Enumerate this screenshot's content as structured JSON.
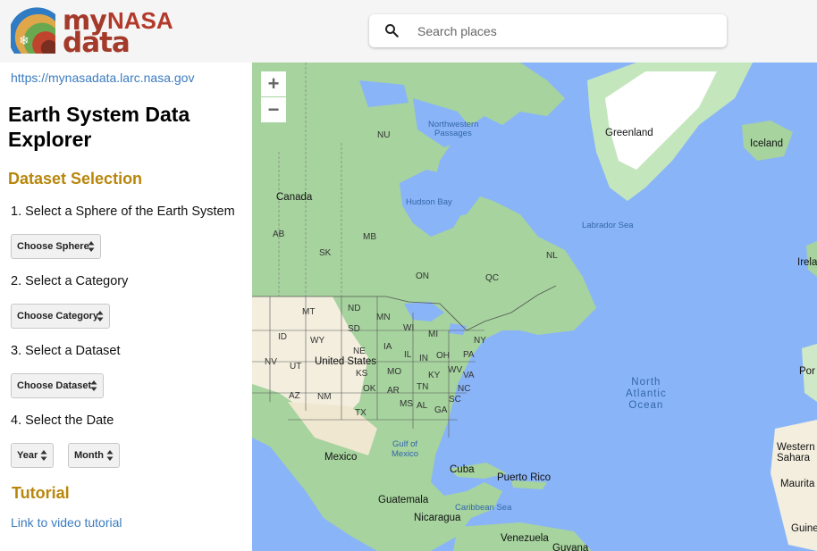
{
  "header": {
    "logo": {
      "word1": "my",
      "word2": "NASA",
      "word3": "data"
    },
    "search": {
      "placeholder": "Search places",
      "value": ""
    }
  },
  "sidebar": {
    "site_link": "https://mynasadata.larc.nasa.gov",
    "title_line1": "Earth System Data",
    "title_line2": "Explorer",
    "dataset_heading": "Dataset Selection",
    "step1": "1. Select a Sphere of the Earth System",
    "sphere_select": "Choose Sphere",
    "step2": "2. Select a Category",
    "category_select": "Choose Category",
    "step3": "3. Select a Dataset",
    "dataset_select": "Choose Dataset",
    "step4": "4. Select the Date",
    "year_select": "Year",
    "month_select": "Month",
    "tutorial_heading": "Tutorial",
    "tutorial_link": "Link to video tutorial"
  },
  "map": {
    "zoom_in": "+",
    "zoom_out": "−",
    "labels": {
      "greenland": "Greenland",
      "iceland": "Iceland",
      "ireland": "Irela",
      "canada": "Canada",
      "nu": "NU",
      "northwestern_passages_1": "Northwestern",
      "northwestern_passages_2": "Passages",
      "hudson_bay": "Hudson Bay",
      "labrador_sea": "Labrador Sea",
      "ab": "AB",
      "mb": "MB",
      "sk": "SK",
      "on": "ON",
      "qc": "QC",
      "nl": "NL",
      "mt": "MT",
      "nd": "ND",
      "mn": "MN",
      "sd": "SD",
      "wy": "WY",
      "id": "ID",
      "wi": "WI",
      "mi": "MI",
      "ny": "NY",
      "ne": "NE",
      "ia": "IA",
      "nv": "NV",
      "ut": "UT",
      "united_states": "United States",
      "il": "IL",
      "in": "IN",
      "oh": "OH",
      "pa": "PA",
      "mo": "MO",
      "ks": "KS",
      "ky": "KY",
      "wv": "WV",
      "va": "VA",
      "az": "AZ",
      "nm": "NM",
      "ok": "OK",
      "ar": "AR",
      "tn": "TN",
      "nc": "NC",
      "sc": "SC",
      "tx": "TX",
      "ms": "MS",
      "al": "AL",
      "ga": "GA",
      "north_atlantic_1": "North",
      "north_atlantic_2": "Atlantic",
      "north_atlantic_3": "Ocean",
      "portugal": "Por",
      "gulf_1": "Gulf of",
      "gulf_2": "Mexico",
      "mexico": "Mexico",
      "cuba": "Cuba",
      "puerto_rico": "Puerto Rico",
      "western_sahara_1": "Western",
      "western_sahara_2": "Sahara",
      "mauritania": "Maurita",
      "guatemala": "Guatemala",
      "caribbean_sea": "Caribbean Sea",
      "nicaragua": "Nicaragua",
      "venezuela": "Venezuela",
      "guyana": "Guyana",
      "guinea": "Guine"
    }
  },
  "colors": {
    "accent_heading": "#b8860b",
    "link": "#3a7bbf",
    "ocean": "#8ab4f8",
    "land_green": "#9fd19a",
    "land_tan": "#f3eede"
  }
}
